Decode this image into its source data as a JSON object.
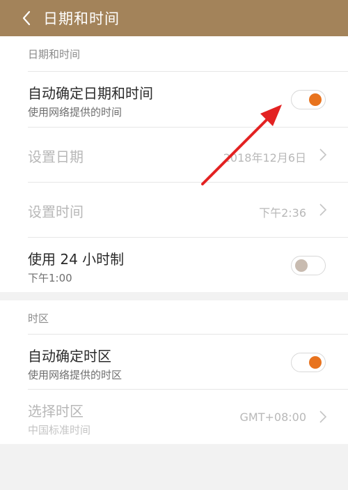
{
  "header": {
    "title": "日期和时间"
  },
  "sections": {
    "datetime": {
      "label": "日期和时间",
      "auto_datetime": {
        "title": "自动确定日期和时间",
        "subtitle": "使用网络提供的时间",
        "enabled": true
      },
      "set_date": {
        "title": "设置日期",
        "value": "2018年12月6日"
      },
      "set_time": {
        "title": "设置时间",
        "value": "下午2:36"
      },
      "use_24h": {
        "title": "使用 24 小时制",
        "subtitle": "下午1:00",
        "enabled": false
      }
    },
    "timezone": {
      "label": "时区",
      "auto_timezone": {
        "title": "自动确定时区",
        "subtitle": "使用网络提供的时区",
        "enabled": true
      },
      "select_timezone": {
        "title": "选择时区",
        "subtitle": "中国标准时间",
        "value": "GMT+08:00"
      }
    }
  },
  "colors": {
    "header_bg": "#a3835a",
    "toggle_on": "#e8731e",
    "toggle_off": "#c8bbb0",
    "annotation_arrow": "#e32222"
  }
}
